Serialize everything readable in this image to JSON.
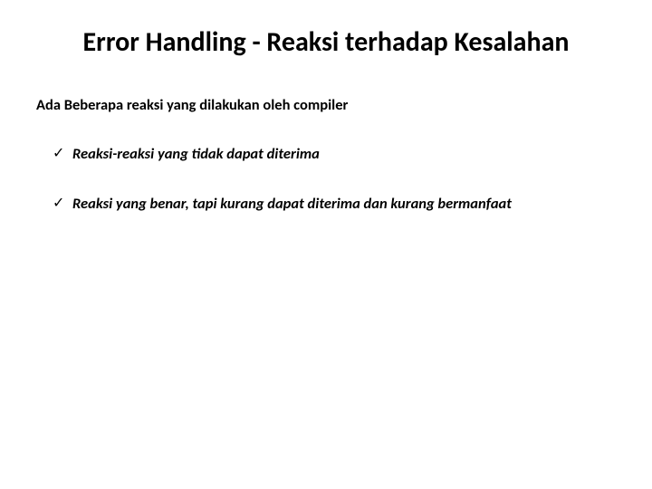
{
  "title": "Error Handling - Reaksi terhadap Kesalahan",
  "intro": "Ada Beberapa reaksi yang dilakukan oleh compiler",
  "check_glyph": "✓",
  "bullets": [
    {
      "text": "Reaksi-reaksi yang tidak dapat diterima"
    },
    {
      "text": "Reaksi yang benar, tapi kurang dapat diterima dan kurang bermanfaat"
    }
  ]
}
